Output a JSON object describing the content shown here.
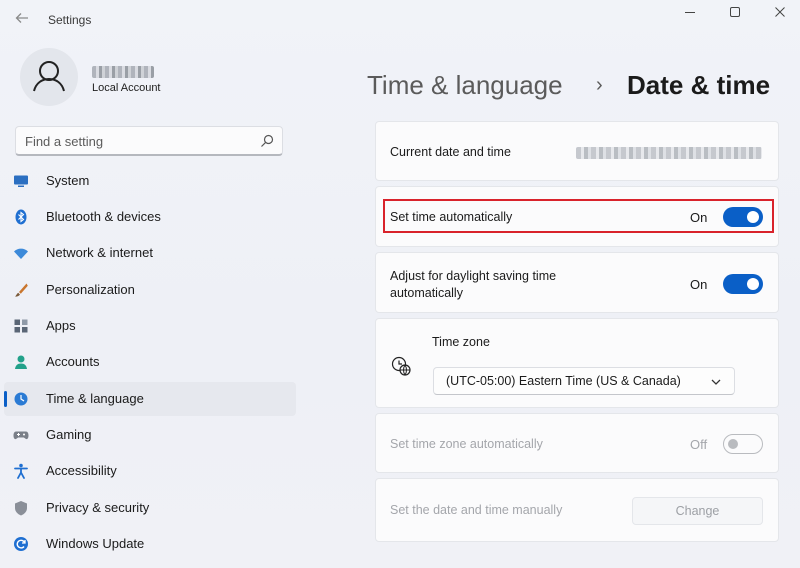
{
  "window": {
    "title": "Settings",
    "controls": {
      "minimize": "—",
      "maximize": "☐",
      "close": "✕"
    },
    "back_icon": "back-arrow-icon"
  },
  "profile": {
    "account_type": "Local Account",
    "name_blurred": true
  },
  "search": {
    "placeholder": "Find a setting",
    "icon": "search-icon"
  },
  "nav": {
    "items": [
      {
        "label": "System",
        "icon": "system-icon",
        "color": "#2b6fc1"
      },
      {
        "label": "Bluetooth & devices",
        "icon": "bluetooth-icon",
        "color": "#1f6fd1"
      },
      {
        "label": "Network & internet",
        "icon": "wifi-icon",
        "color": "#3d8ad9"
      },
      {
        "label": "Personalization",
        "icon": "brush-icon",
        "color": "#c9762e"
      },
      {
        "label": "Apps",
        "icon": "apps-icon",
        "color": "#5a6676"
      },
      {
        "label": "Accounts",
        "icon": "accounts-icon",
        "color": "#22a18a"
      },
      {
        "label": "Time & language",
        "icon": "globe-clock-icon",
        "color": "#2b7bd4",
        "active": true
      },
      {
        "label": "Gaming",
        "icon": "gamepad-icon",
        "color": "#7a7f88"
      },
      {
        "label": "Accessibility",
        "icon": "accessibility-icon",
        "color": "#1f6fd1"
      },
      {
        "label": "Privacy & security",
        "icon": "shield-icon",
        "color": "#8a8f98"
      },
      {
        "label": "Windows Update",
        "icon": "update-icon",
        "color": "#1f6fd1"
      }
    ]
  },
  "breadcrumb": {
    "parent": "Time & language",
    "separator": "›",
    "current": "Date & time"
  },
  "settings": {
    "current_datetime": {
      "label": "Current date and time",
      "value_blurred": true
    },
    "set_time_auto": {
      "label": "Set time automatically",
      "state": "On",
      "on": true
    },
    "daylight_saving": {
      "label_line1": "Adjust for daylight saving time",
      "label_line2": "automatically",
      "state": "On",
      "on": true
    },
    "time_zone": {
      "label": "Time zone",
      "value": "(UTC-05:00) Eastern Time (US & Canada)",
      "icon": "timezone-globe-icon"
    },
    "set_tz_auto": {
      "label": "Set time zone automatically",
      "state": "Off",
      "on": false,
      "disabled": true
    },
    "manual": {
      "label": "Set the date and time manually",
      "button": "Change",
      "disabled": true
    }
  },
  "colors": {
    "accent": "#0a5fc7",
    "highlight": "#d9232b"
  }
}
